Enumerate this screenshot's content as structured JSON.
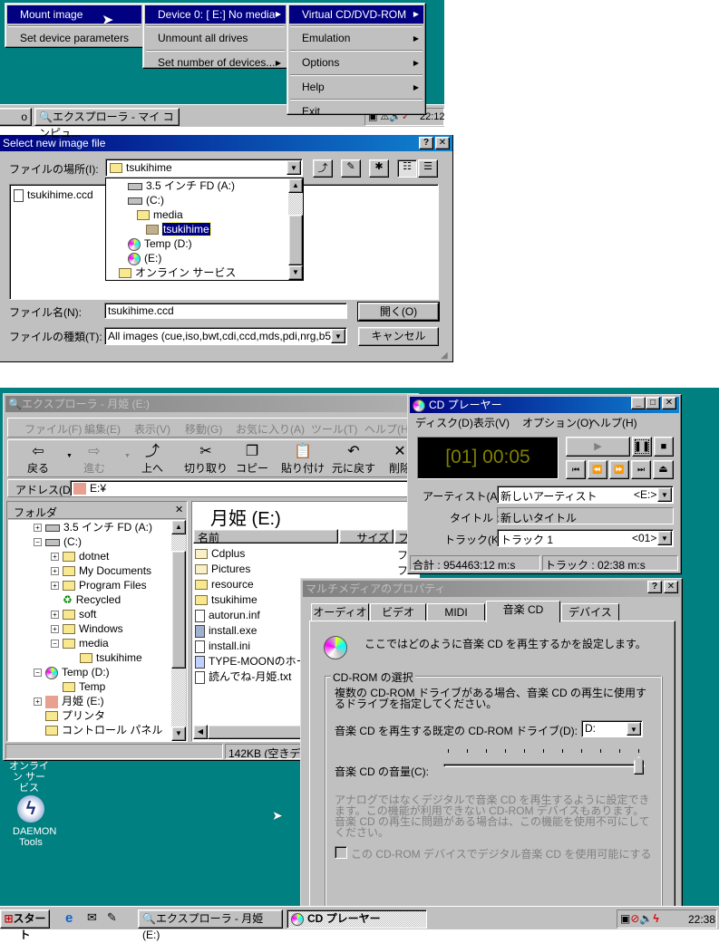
{
  "top": {
    "menu1": {
      "items": [
        "Mount image",
        "Set device parameters"
      ]
    },
    "menu2": {
      "items": [
        "Device 0: [ E:] No media",
        "Unmount all drives",
        "Set number of devices..."
      ]
    },
    "menu3": {
      "items": [
        "Virtual CD/DVD-ROM",
        "Emulation",
        "Options",
        "Help",
        "Exit"
      ]
    },
    "taskbar": {
      "partial_button": "o",
      "explorer_button": "エクスプローラ - マイ コンピュ...",
      "clock": "22:12"
    }
  },
  "dialog": {
    "title": "Select new image file",
    "look_in_label": "ファイルの場所(I):",
    "look_in_value": "tsukihime",
    "dropdown_items": [
      "3.5 インチ FD (A:)",
      "(C:)",
      "media",
      "tsukihime",
      "Temp (D:)",
      "(E:)",
      "オンライン サービス"
    ],
    "files": [
      "tsukihime.ccd"
    ],
    "filename_label": "ファイル名(N):",
    "filename_value": "tsukihime.ccd",
    "filetype_label": "ファイルの種類(T):",
    "filetype_value": "All images (cue,iso,bwt,cdi,ccd,mds,pdi,nrg,b5t)",
    "open_button": "開く(O)",
    "cancel_button": "キャンセル"
  },
  "explorer": {
    "title": "エクスプローラ - 月姫 (E:)",
    "menu": [
      "ファイル(F)",
      "編集(E)",
      "表示(V)",
      "移動(G)",
      "お気に入り(A)",
      "ツール(T)",
      "ヘルプ(H)"
    ],
    "toolbar": [
      "戻る",
      "進む",
      "上へ",
      "切り取り",
      "コピー",
      "貼り付け",
      "元に戻す",
      "削除"
    ],
    "address_label": "アドレス(D)",
    "address_value": "E:¥",
    "folder_pane_title": "フォルダ",
    "tree": [
      "3.5 インチ FD (A:)",
      "(C:)",
      "dotnet",
      "My Documents",
      "Program Files",
      "Recycled",
      "soft",
      "Windows",
      "media",
      "tsukihime",
      "Temp (D:)",
      "Temp",
      "月姫 (E:)",
      "プリンタ",
      "コントロール パネル"
    ],
    "heading": "月姫 (E:)",
    "columns": [
      "名前",
      "サイズ",
      "フ"
    ],
    "files": [
      "Cdplus",
      "Pictures",
      "resource",
      "tsukihime",
      "autorun.inf",
      "install.exe",
      "install.ini",
      "TYPE-MOONのホー...",
      "読んでね-月姫.txt"
    ],
    "type_partial": [
      "フ",
      "フ"
    ],
    "status": "142KB (空きディ"
  },
  "cdplayer": {
    "title": "CD プレーヤー",
    "menu": [
      "ディスク(D)",
      "表示(V)",
      "オプション(O)",
      "ヘルプ(H)"
    ],
    "display": "[01] 00:05",
    "display_color": "#808000",
    "artist_label": "アーティスト(A):",
    "artist_value": "新しいアーティスト",
    "artist_drive": "<E:>",
    "title_label": "タイトル :",
    "title_value": "新しいタイトル",
    "track_label": "トラック(K):",
    "track_value": "トラック 1",
    "track_num": "<01>",
    "status_total": "合計 : 954463:12 m:s",
    "status_track": "トラック : 02:38 m:s"
  },
  "mmprops": {
    "title": "マルチメディアのプロパティ",
    "tabs": [
      "オーディオ",
      "ビデオ",
      "MIDI",
      "音楽 CD",
      "デバイス"
    ],
    "active_tab": "音楽 CD",
    "intro": "ここではどのように音楽 CD を再生するかを設定します。",
    "group_title": "CD-ROM の選択",
    "group_desc": "複数の CD-ROM ドライブがある場合、音楽 CD の再生に使用するドライブを指定してください。",
    "drive_label": "音楽 CD を再生する既定の CD-ROM ドライブ(D):",
    "drive_value": "D:",
    "volume_label": "音楽 CD の音量(C):",
    "volume_level": 1.0,
    "digital_desc": "アナログではなくデジタルで音楽 CD を再生するように設定できます。この機能が利用できない CD-ROM デバイスもあります。音楽 CD の再生に問題がある場合は、この機能を使用不可にしてください。",
    "digital_checkbox": "この CD-ROM デバイスでデジタル音楽 CD を使用可能にする",
    "digital_checked": false
  },
  "desktop": {
    "icons": [
      "オンライン サービス",
      "DAEMON Tools"
    ]
  },
  "taskbar": {
    "start": "スタート",
    "buttons": [
      "エクスプローラ - 月姫 (E:)",
      "CD プレーヤー"
    ],
    "clock": "22:38"
  },
  "colors": {
    "desktop": "#008080",
    "selection": "#000080",
    "face": "#c0c0c0"
  }
}
